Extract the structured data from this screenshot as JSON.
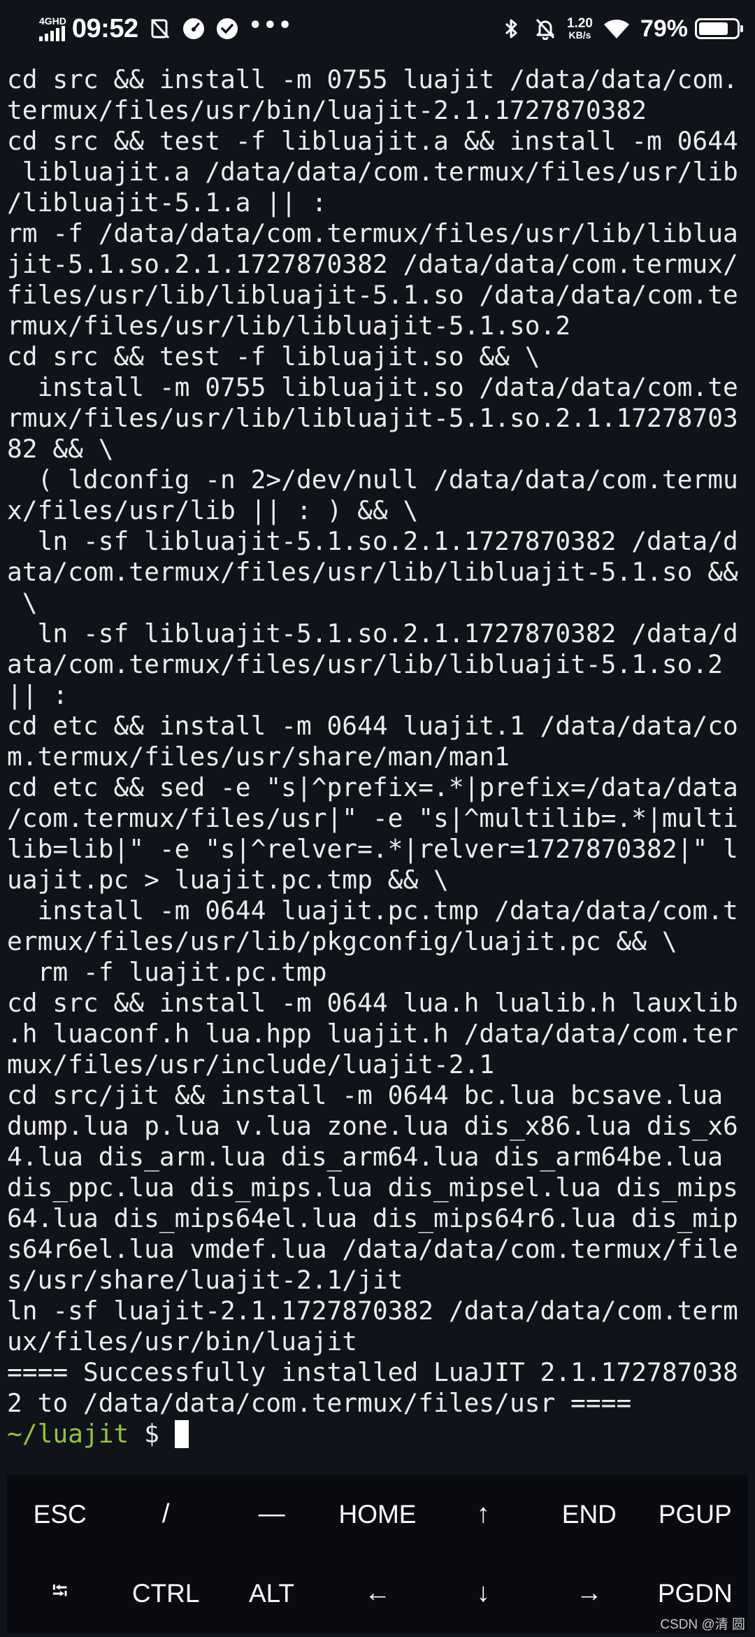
{
  "status_bar": {
    "network_type": "4GHD",
    "time": "09:52",
    "speed_value": "1.20",
    "speed_unit": "KB/s",
    "battery_percent": "79%",
    "battery_level": 0.79
  },
  "terminal": {
    "lines": [
      "cd src && install -m 0755 luajit /data/data/com.",
      "termux/files/usr/bin/luajit-2.1.1727870382",
      "cd src && test -f libluajit.a && install -m 0644",
      " libluajit.a /data/data/com.termux/files/usr/lib",
      "/libluajit-5.1.a || :",
      "rm -f /data/data/com.termux/files/usr/lib/liblua",
      "jit-5.1.so.2.1.1727870382 /data/data/com.termux/",
      "files/usr/lib/libluajit-5.1.so /data/data/com.te",
      "rmux/files/usr/lib/libluajit-5.1.so.2",
      "cd src && test -f libluajit.so && \\",
      "  install -m 0755 libluajit.so /data/data/com.te",
      "rmux/files/usr/lib/libluajit-5.1.so.2.1.17278703",
      "82 && \\",
      "  ( ldconfig -n 2>/dev/null /data/data/com.termu",
      "x/files/usr/lib || : ) && \\",
      "  ln -sf libluajit-5.1.so.2.1.1727870382 /data/d",
      "ata/com.termux/files/usr/lib/libluajit-5.1.so &&",
      " \\",
      "  ln -sf libluajit-5.1.so.2.1.1727870382 /data/d",
      "ata/com.termux/files/usr/lib/libluajit-5.1.so.2",
      "|| :",
      "cd etc && install -m 0644 luajit.1 /data/data/co",
      "m.termux/files/usr/share/man/man1",
      "cd etc && sed -e \"s|^prefix=.*|prefix=/data/data",
      "/com.termux/files/usr|\" -e \"s|^multilib=.*|multi",
      "lib=lib|\" -e \"s|^relver=.*|relver=1727870382|\" l",
      "uajit.pc > luajit.pc.tmp && \\",
      "  install -m 0644 luajit.pc.tmp /data/data/com.t",
      "ermux/files/usr/lib/pkgconfig/luajit.pc && \\",
      "  rm -f luajit.pc.tmp",
      "cd src && install -m 0644 lua.h lualib.h lauxlib",
      ".h luaconf.h lua.hpp luajit.h /data/data/com.ter",
      "mux/files/usr/include/luajit-2.1",
      "cd src/jit && install -m 0644 bc.lua bcsave.lua",
      "dump.lua p.lua v.lua zone.lua dis_x86.lua dis_x6",
      "4.lua dis_arm.lua dis_arm64.lua dis_arm64be.lua",
      "dis_ppc.lua dis_mips.lua dis_mipsel.lua dis_mips",
      "64.lua dis_mips64el.lua dis_mips64r6.lua dis_mip",
      "s64r6el.lua vmdef.lua /data/data/com.termux/file",
      "s/usr/share/luajit-2.1/jit",
      "ln -sf luajit-2.1.1727870382 /data/data/com.term",
      "ux/files/usr/bin/luajit",
      "==== Successfully installed LuaJIT 2.1.172787038",
      "2 to /data/data/com.termux/files/usr ===="
    ],
    "prompt_path": "~/luajit",
    "prompt_symbol": "$"
  },
  "extra_keys": {
    "row1": [
      "ESC",
      "/",
      "—",
      "HOME",
      "↑",
      "END",
      "PGUP"
    ],
    "row2": [
      "⭾",
      "CTRL",
      "ALT",
      "←",
      "↓",
      "→",
      "PGDN"
    ]
  },
  "watermark": "CSDN @清 圆",
  "colors": {
    "background": "#11131a",
    "text": "#ececec",
    "prompt": "#8fc53f",
    "keys_background": "#090b10"
  },
  "icons": {
    "status_left": [
      "sim-off-icon",
      "gauge-icon",
      "check-circle-icon"
    ],
    "status_right": [
      "bluetooth-icon",
      "bell-muted-icon",
      "wifi-icon",
      "battery-icon"
    ]
  }
}
